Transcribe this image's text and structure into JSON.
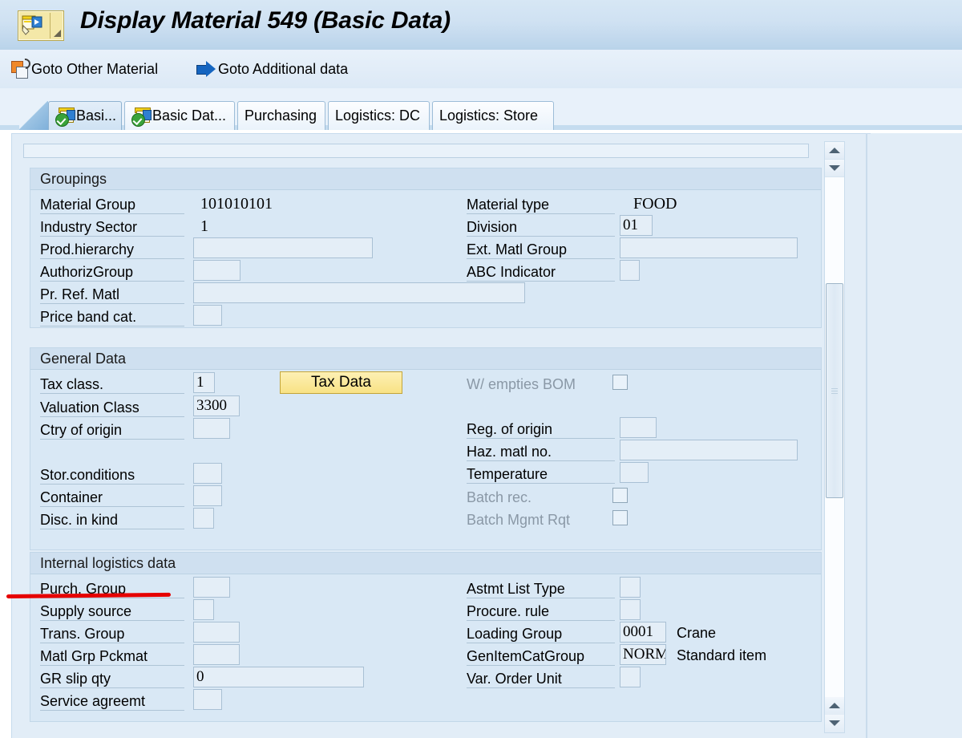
{
  "window": {
    "title": "Display Material 549 (Basic Data)",
    "app_icon": "display-material-icon"
  },
  "toolbar": {
    "items": [
      {
        "label": "Goto Other Material",
        "icon": "copy-material-icon"
      },
      {
        "label": "Goto Additional data",
        "icon": "blue-arrow-icon"
      }
    ]
  },
  "tabs": [
    {
      "label": "Basi...",
      "icon": "basic-data-icon",
      "selected": true
    },
    {
      "label": "Basic Dat...",
      "icon": "basic-data-icon",
      "selected": false
    },
    {
      "label": "Purchasing",
      "icon": "",
      "selected": false
    },
    {
      "label": "Logistics: DC",
      "icon": "",
      "selected": false
    },
    {
      "label": "Logistics: Store",
      "icon": "",
      "selected": false
    }
  ],
  "groups": {
    "groupings": {
      "title": "Groupings",
      "left": [
        {
          "label": "Material Group",
          "value": "101010101",
          "kind": "text"
        },
        {
          "label": "Industry Sector",
          "value": "1",
          "kind": "text"
        },
        {
          "label": "Prod.hierarchy",
          "value": "",
          "kind": "input"
        },
        {
          "label": "AuthorizGroup",
          "value": "",
          "kind": "input"
        },
        {
          "label": "Pr. Ref. Matl",
          "value": "",
          "kind": "input"
        },
        {
          "label": "Price band cat.",
          "value": "",
          "kind": "input"
        }
      ],
      "right": [
        {
          "label": "Material type",
          "value": "FOOD",
          "kind": "text"
        },
        {
          "label": "Division",
          "value": "01",
          "kind": "input"
        },
        {
          "label": "Ext. Matl Group",
          "value": "",
          "kind": "input"
        },
        {
          "label": "ABC Indicator",
          "value": "",
          "kind": "input"
        }
      ]
    },
    "general_data": {
      "title": "General Data",
      "left": [
        {
          "label": "Tax class.",
          "value": "1",
          "kind": "input"
        },
        {
          "label": "Valuation Class",
          "value": "3300",
          "kind": "input"
        },
        {
          "label": "Ctry of origin",
          "value": "",
          "kind": "input"
        },
        {
          "label": "Stor.conditions",
          "value": "",
          "kind": "input"
        },
        {
          "label": "Container",
          "value": "",
          "kind": "input"
        },
        {
          "label": "Disc. in kind",
          "value": "",
          "kind": "input"
        }
      ],
      "right": [
        {
          "label": "W/ empties BOM",
          "value": "",
          "kind": "checkbox",
          "disabled": true
        },
        {
          "label": "Reg. of origin",
          "value": "",
          "kind": "input"
        },
        {
          "label": "Haz. matl no.",
          "value": "",
          "kind": "input"
        },
        {
          "label": "Temperature",
          "value": "",
          "kind": "input"
        },
        {
          "label": "Batch rec.",
          "value": "",
          "kind": "checkbox",
          "disabled": true
        },
        {
          "label": "Batch Mgmt Rqt",
          "value": "",
          "kind": "checkbox",
          "disabled": true
        }
      ],
      "tax_data_button": "Tax Data"
    },
    "internal_logistics": {
      "title": "Internal logistics data",
      "left": [
        {
          "label": "Purch. Group",
          "value": "",
          "kind": "input"
        },
        {
          "label": "Supply source",
          "value": "",
          "kind": "input"
        },
        {
          "label": "Trans. Group",
          "value": "",
          "kind": "input"
        },
        {
          "label": "Matl Grp Pckmat",
          "value": "",
          "kind": "input"
        },
        {
          "label": "GR slip qty",
          "value": "0",
          "kind": "input"
        },
        {
          "label": "Service agreemt",
          "value": "",
          "kind": "input"
        }
      ],
      "right": [
        {
          "label": "Astmt List Type",
          "value": "",
          "kind": "input",
          "text": ""
        },
        {
          "label": "Procure. rule",
          "value": "",
          "kind": "input",
          "text": ""
        },
        {
          "label": "Loading Group",
          "value": "0001",
          "kind": "input",
          "text": "Crane"
        },
        {
          "label": "GenItemCatGroup",
          "value": "NORM",
          "kind": "input",
          "text": "Standard item"
        },
        {
          "label": "Var. Order Unit",
          "value": "",
          "kind": "input",
          "text": ""
        }
      ]
    }
  },
  "scrollbar": {
    "up_top": "scroll-up-top",
    "down_top": "scroll-down-top",
    "up_bottom": "scroll-up-bottom",
    "down_bottom": "scroll-down-bottom"
  },
  "annotation": {
    "color": "#e60000",
    "target": "Purch. Group"
  },
  "colors": {
    "titlebar": "#cfe1f2",
    "panel": "#d9e8f5",
    "accent_button": "#f8e285",
    "annotation": "#e60000"
  }
}
